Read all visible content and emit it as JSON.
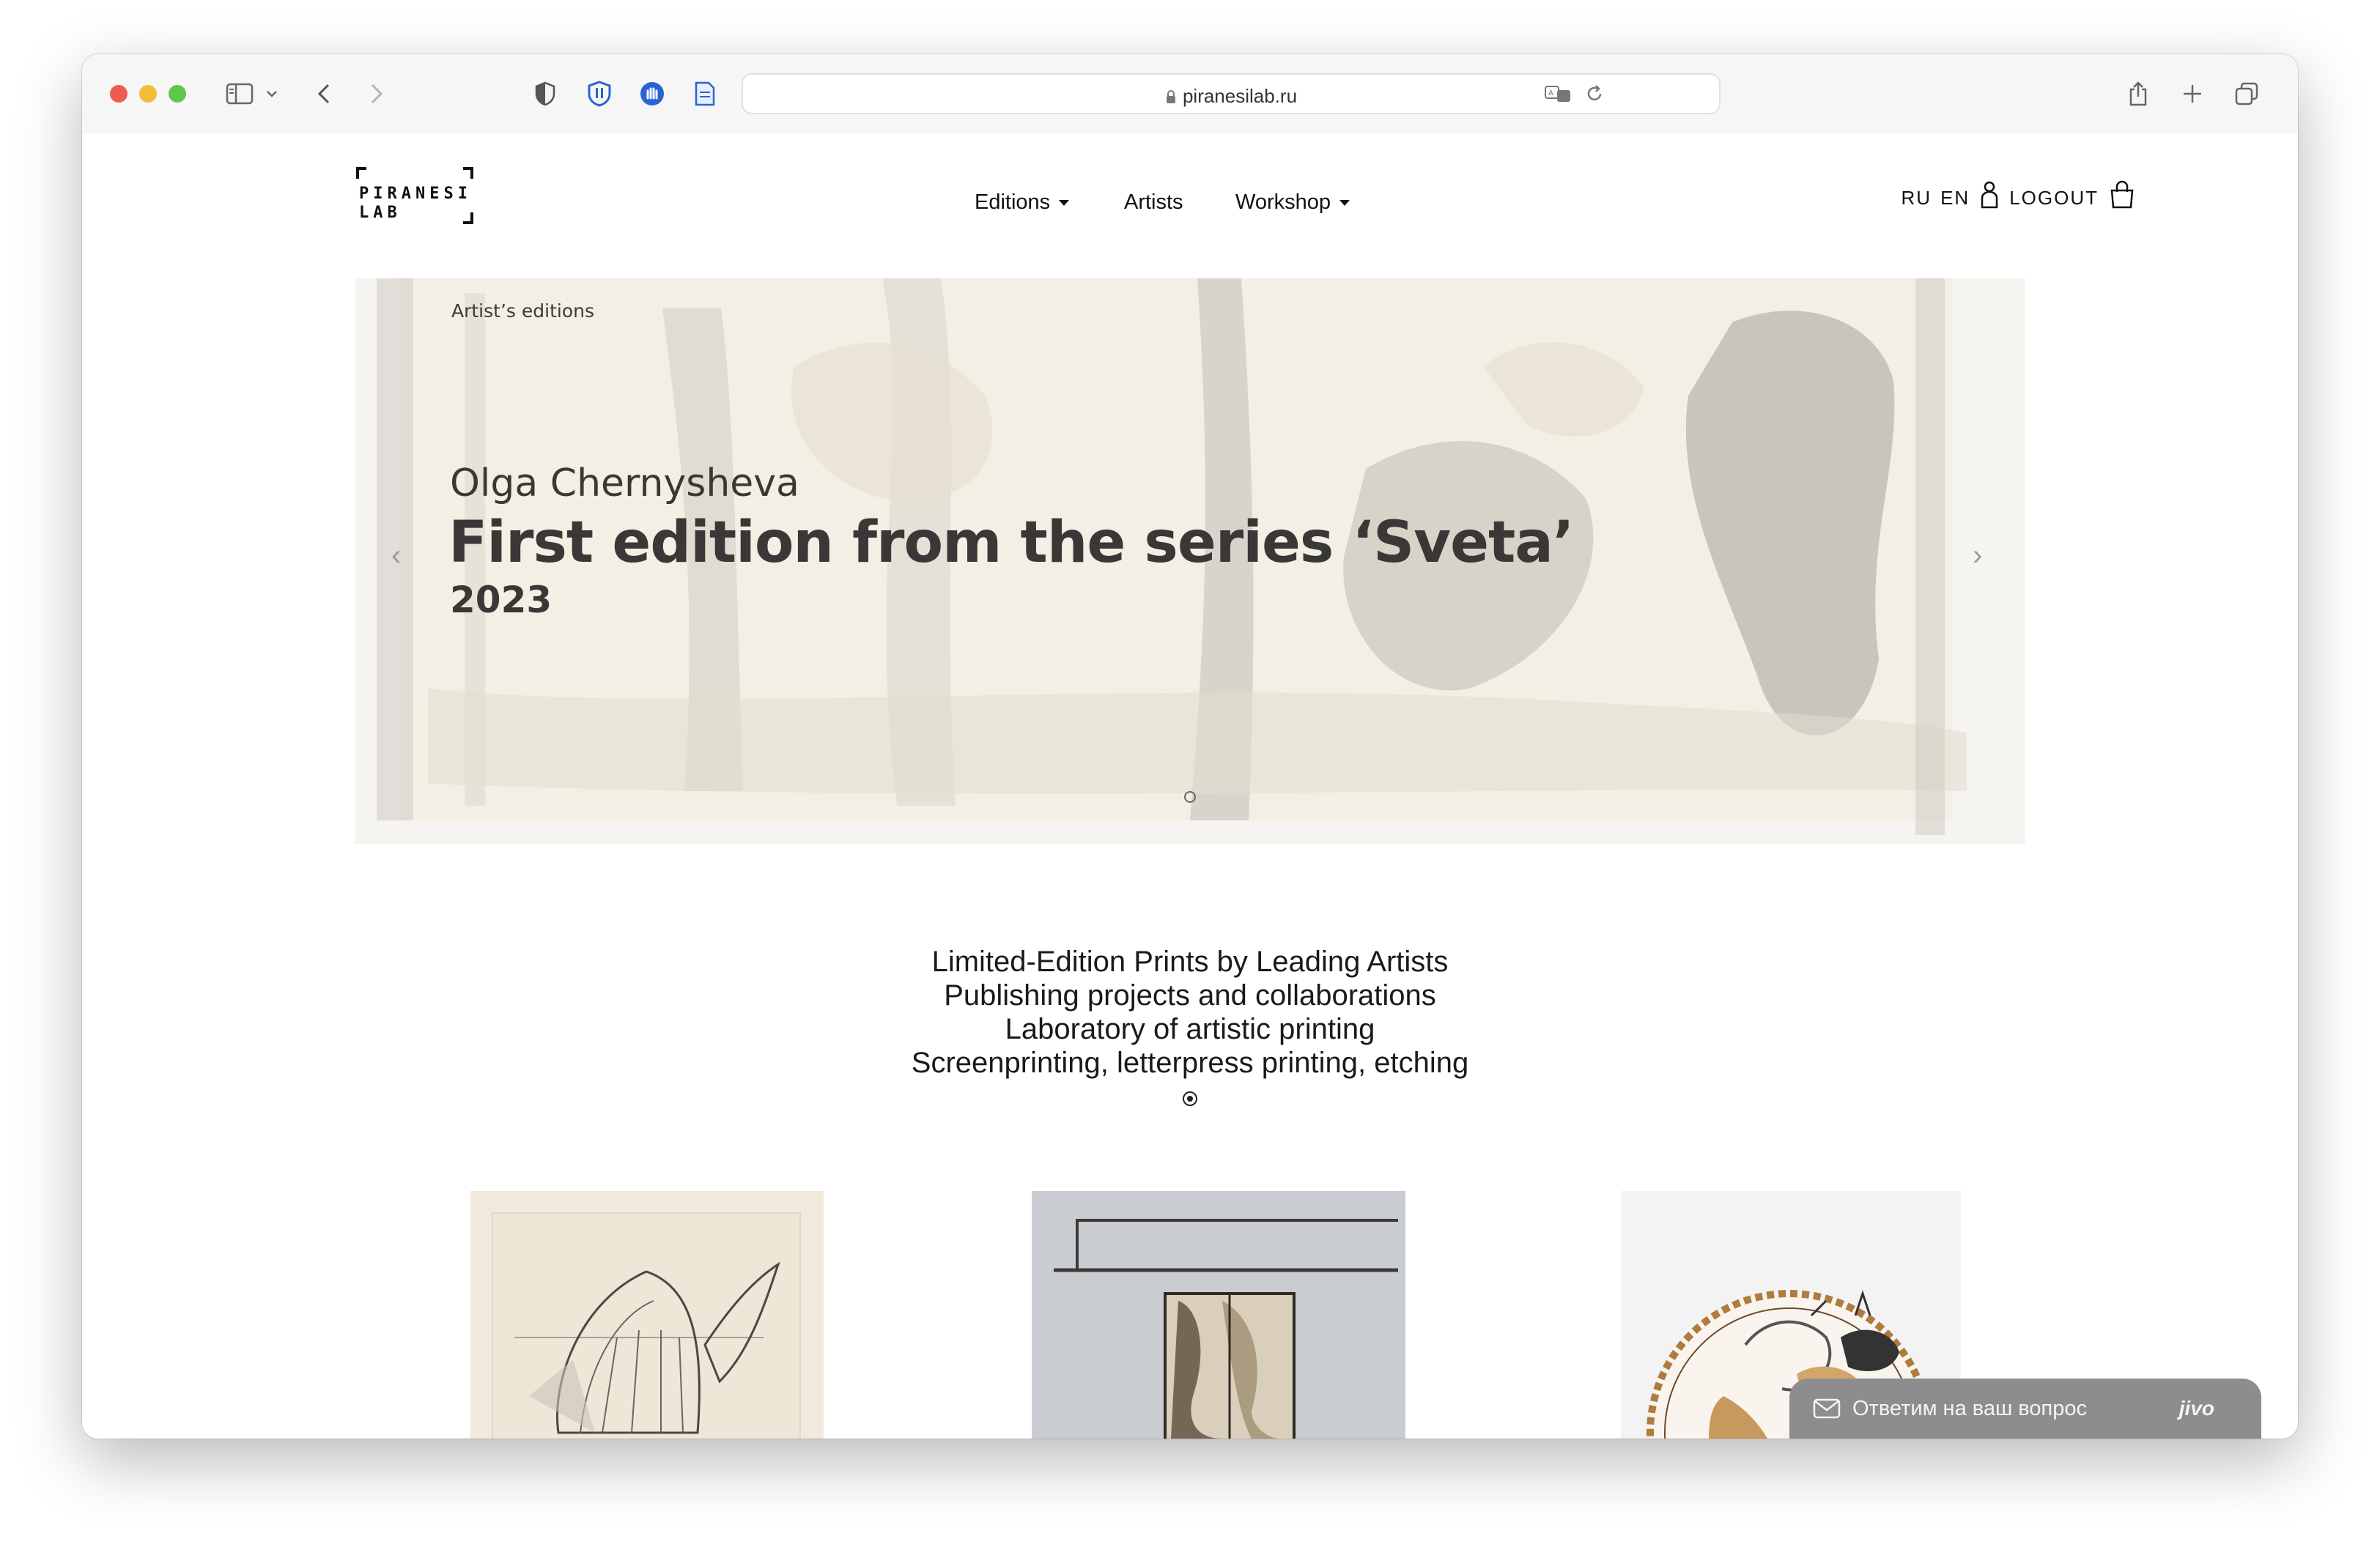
{
  "browser": {
    "url": "piranesilab.ru"
  },
  "site": {
    "logo_line1": "PIRANESI",
    "logo_line2": "LAB",
    "nav": {
      "editions": "Editions",
      "artists": "Artists",
      "workshop": "Workshop"
    },
    "lang_ru": "RU",
    "lang_en": "EN",
    "logout": "LOGOUT"
  },
  "hero": {
    "tag": "Artist’s editions",
    "artist": "Olga Chernysheva",
    "title": "First edition from the series ‘Sveta’",
    "year": "2023",
    "prev_arrow": "‹",
    "next_arrow": "›"
  },
  "taglines": [
    "Limited-Edition Prints by Leading Artists",
    "Publishing projects and collaborations",
    "Laboratory of artistic printing",
    "Screenprinting, letterpress printing, etching"
  ],
  "chat": {
    "label": "Ответим на ваш вопрос",
    "brand": "jivo"
  },
  "colors": {
    "traffic_red": "#ee5b52",
    "traffic_yellow": "#f4bd38",
    "traffic_green": "#5cc74a",
    "hero_bg": "#efede8",
    "chat_bg": "#8d8d8d"
  }
}
